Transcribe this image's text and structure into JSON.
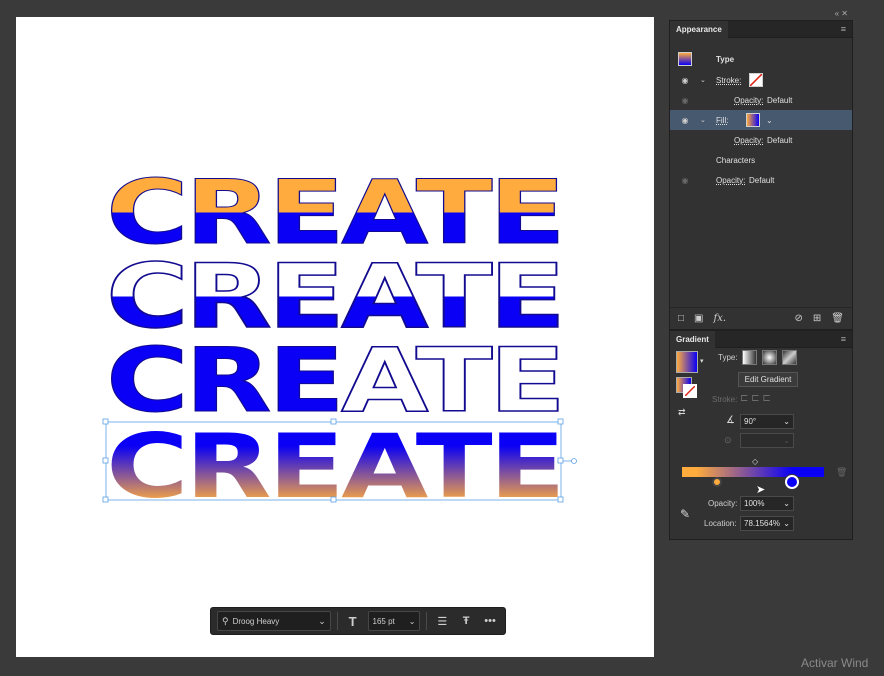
{
  "artboard": {
    "word": "CREATE",
    "fill_top_color": "#FFAB3D",
    "fill_bottom_color": "#0A00F5",
    "outline_color": "#120A8F"
  },
  "context_toolbar": {
    "font_name": "Droog Heavy",
    "font_size": "165 pt",
    "icons": [
      "search-icon",
      "chevron-down-icon",
      "font-size-icon",
      "chevron-down-icon",
      "paragraph-icon",
      "type-options-icon",
      "more-icon"
    ]
  },
  "appearance_panel": {
    "tab_label": "Appearance",
    "type_label": "Type",
    "stroke_label": "Stroke:",
    "stroke_opacity_label": "Opacity:",
    "stroke_opacity_value": "Default",
    "fill_label": "Fill:",
    "fill_opacity_label": "Opacity:",
    "fill_opacity_value": "Default",
    "characters_label": "Characters",
    "opacity_label": "Opacity:",
    "opacity_value": "Default",
    "fx_label": "fx."
  },
  "gradient_panel": {
    "tab_label": "Gradient",
    "type_label": "Type:",
    "edit_button": "Edit Gradient",
    "stroke_label": "Stroke:",
    "angle_value": "90°",
    "opacity_label": "Opacity:",
    "opacity_value": "100%",
    "location_label": "Location:",
    "location_value": "78.1564%",
    "start_color": "#FFAB3D",
    "end_color": "#0A00F5"
  },
  "watermark": "Activar Wind"
}
